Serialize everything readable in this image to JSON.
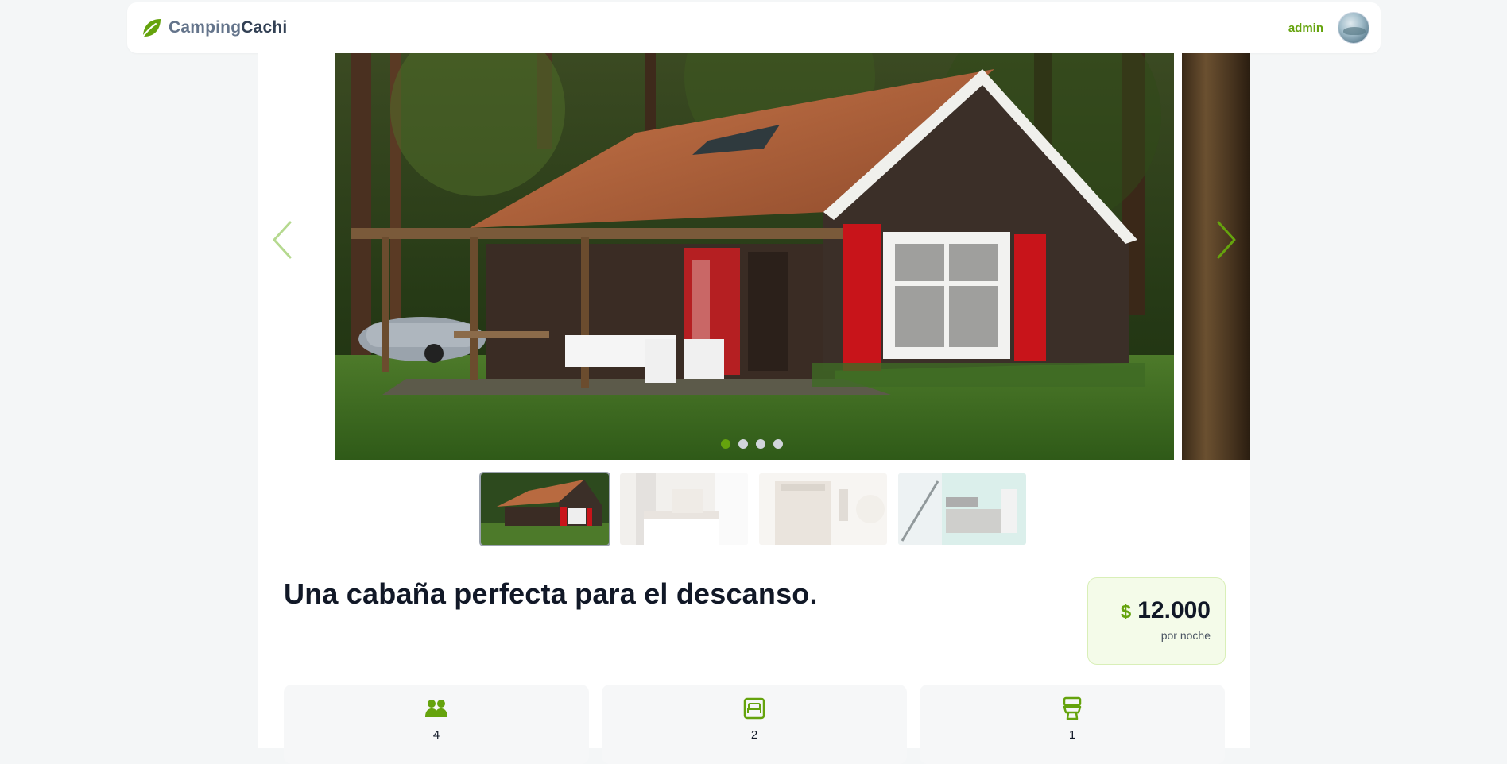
{
  "header": {
    "brand_part1": "Camping",
    "brand_part2": "Cachi",
    "username": "admin"
  },
  "carousel": {
    "dots": 4,
    "active_index": 0
  },
  "thumbnails": [
    {
      "subject": "cabin-exterior",
      "active": true
    },
    {
      "subject": "bedroom",
      "active": false
    },
    {
      "subject": "bathroom",
      "active": false
    },
    {
      "subject": "kitchen",
      "active": false
    }
  ],
  "listing": {
    "title": "Una cabaña perfecta para el descanso.",
    "currency_symbol": "$",
    "price": "12.000",
    "price_unit": "por noche"
  },
  "features": [
    {
      "icon": "guests-icon",
      "value": "4"
    },
    {
      "icon": "bed-icon",
      "value": "2"
    },
    {
      "icon": "toilet-icon",
      "value": "1"
    }
  ],
  "colors": {
    "accent": "#65a30d",
    "price_bg": "#f4fbe9"
  }
}
